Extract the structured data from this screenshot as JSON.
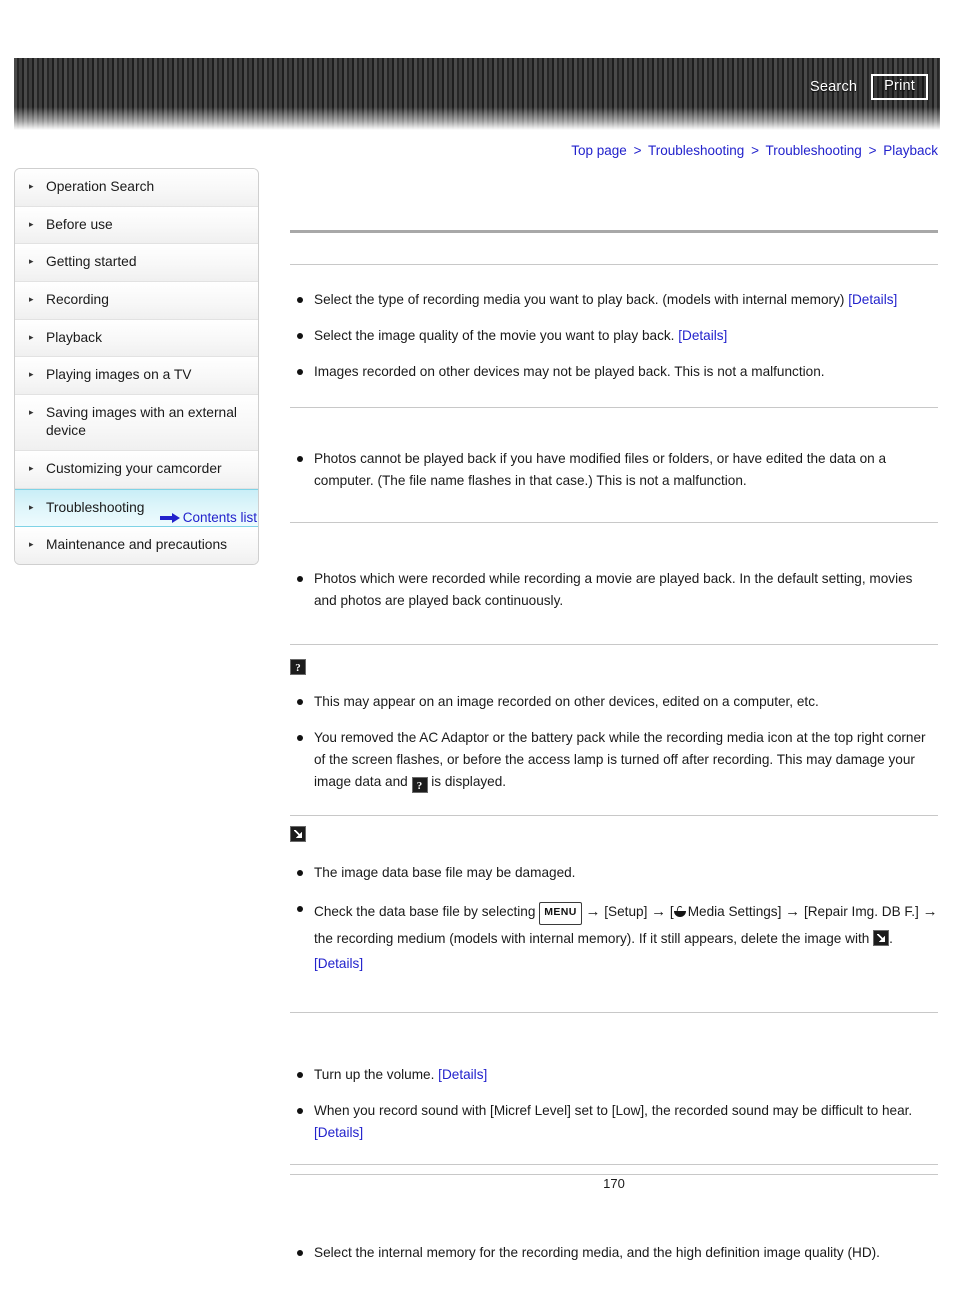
{
  "header": {
    "search_label": "Search",
    "print_label": "Print"
  },
  "breadcrumb": {
    "separator": ">",
    "items": [
      "Top page",
      "Troubleshooting",
      "Troubleshooting",
      "Playback"
    ]
  },
  "sidebar": {
    "items": [
      {
        "label": "Operation Search",
        "active": false
      },
      {
        "label": "Before use",
        "active": false
      },
      {
        "label": "Getting started",
        "active": false
      },
      {
        "label": "Recording",
        "active": false
      },
      {
        "label": "Playback",
        "active": false
      },
      {
        "label": "Playing images on a TV",
        "active": false
      },
      {
        "label": "Saving images with an external device",
        "active": false
      },
      {
        "label": "Customizing your camcorder",
        "active": false
      },
      {
        "label": "Troubleshooting",
        "active": true
      },
      {
        "label": "Maintenance and precautions",
        "active": false
      }
    ],
    "contents_list_label": "Contents list"
  },
  "content": {
    "sections": [
      {
        "title": "",
        "bullets": [
          {
            "text": "Select the type of recording media you want to play back. (models with internal memory) ",
            "link": "[Details]"
          },
          {
            "text": "Select the image quality of the movie you want to play back. ",
            "link": "[Details]"
          },
          {
            "text": "Images recorded on other devices may not be played back. This is not a malfunction.",
            "link": ""
          }
        ]
      },
      {
        "title": "",
        "bullets": [
          {
            "text": "Photos cannot be played back if you have modified files or folders, or have edited the data on a computer. (The file name flashes in that case.) This is not a malfunction.",
            "link": ""
          }
        ]
      },
      {
        "title": "",
        "bullets": [
          {
            "text": "Photos which were recorded while recording a movie are played back. In the default setting, movies and photos are played back continuously.",
            "link": ""
          }
        ]
      },
      {
        "title_icon": "question-badge-icon",
        "title": "",
        "bullets": [
          {
            "text": "This may appear on an image recorded on other devices, edited on a computer, etc.",
            "link": ""
          },
          {
            "text": "You removed the AC Adaptor or the battery pack while the recording media icon at the top right corner of the screen flashes, or before the access lamp is turned off after recording. This may damage your image data and ",
            "link": "",
            "suffix": " is displayed.",
            "inline_icon": "question-badge-icon"
          }
        ]
      },
      {
        "title_icon": "delete-badge-icon",
        "title": "",
        "bullets": [
          {
            "text": "The image data base file may be damaged.",
            "link": ""
          },
          {
            "text": "Check the data base file by selecting ",
            "link": "[Details]"
          }
        ]
      },
      {
        "title": "",
        "bullets": [
          {
            "text": "Turn up the volume. ",
            "link": "[Details]"
          },
          {
            "text": "When you record sound with [Micref Level] set to [Low], the recorded sound may be difficult to hear. ",
            "link": "[Details]"
          }
        ]
      },
      {
        "title": "",
        "bullets": [
          {
            "text": "Select the internal memory for the recording media, and the high definition image quality (HD).",
            "link": ""
          }
        ]
      }
    ],
    "db_steps": {
      "lead": "Check the data base file by selecting ",
      "menu_label": "MENU",
      "arrow": "→",
      "setup": "[Setup]",
      "media_settings": "Media Settings]",
      "media_settings_open": "[",
      "repair": "[Repair Img. DB F.]",
      "tail": " the recording medium (models with internal memory). If it still appears, delete the image with ",
      "tail2": ". ",
      "details": "[Details]"
    }
  },
  "footer": {
    "page_number": "170"
  },
  "colors": {
    "link": "#2222cc",
    "active_item": "#c9eef7",
    "header_bar": "#3a3a3a"
  }
}
